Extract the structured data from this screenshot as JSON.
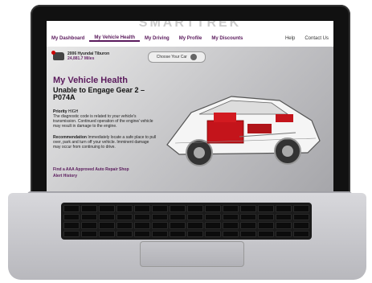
{
  "brand": "SMARTTREK",
  "nav": {
    "items": [
      "My Dashboard",
      "My Vehicle Health",
      "My Driving",
      "My Profile",
      "My Discounts"
    ],
    "active": "My Vehicle Health",
    "help": "Help",
    "contact": "Contact Us"
  },
  "vehicle": {
    "name": "2006 Hyundai Tiburon",
    "miles": "24,881.7 Miles",
    "choose_label": "Choose Your Car"
  },
  "health": {
    "title": "My Vehicle Health",
    "subtitle": "Unable to Engage Gear 2 – P074A",
    "priority_label": "Priority",
    "priority_value": "HIGH",
    "description": "The diagnostic code is related to your vehicle's transmission. Continued operation of the engine/ vehicle may result in damage to the engine.",
    "recommendation_label": "Recommendation",
    "recommendation": "Immediately locate a safe place to pull over, park and turn off your vehicle. Imminent damage may occur from continuing to drive.",
    "link_shop": "Find a AAA Approved Auto Repair Shop",
    "link_history": "Alert History"
  }
}
